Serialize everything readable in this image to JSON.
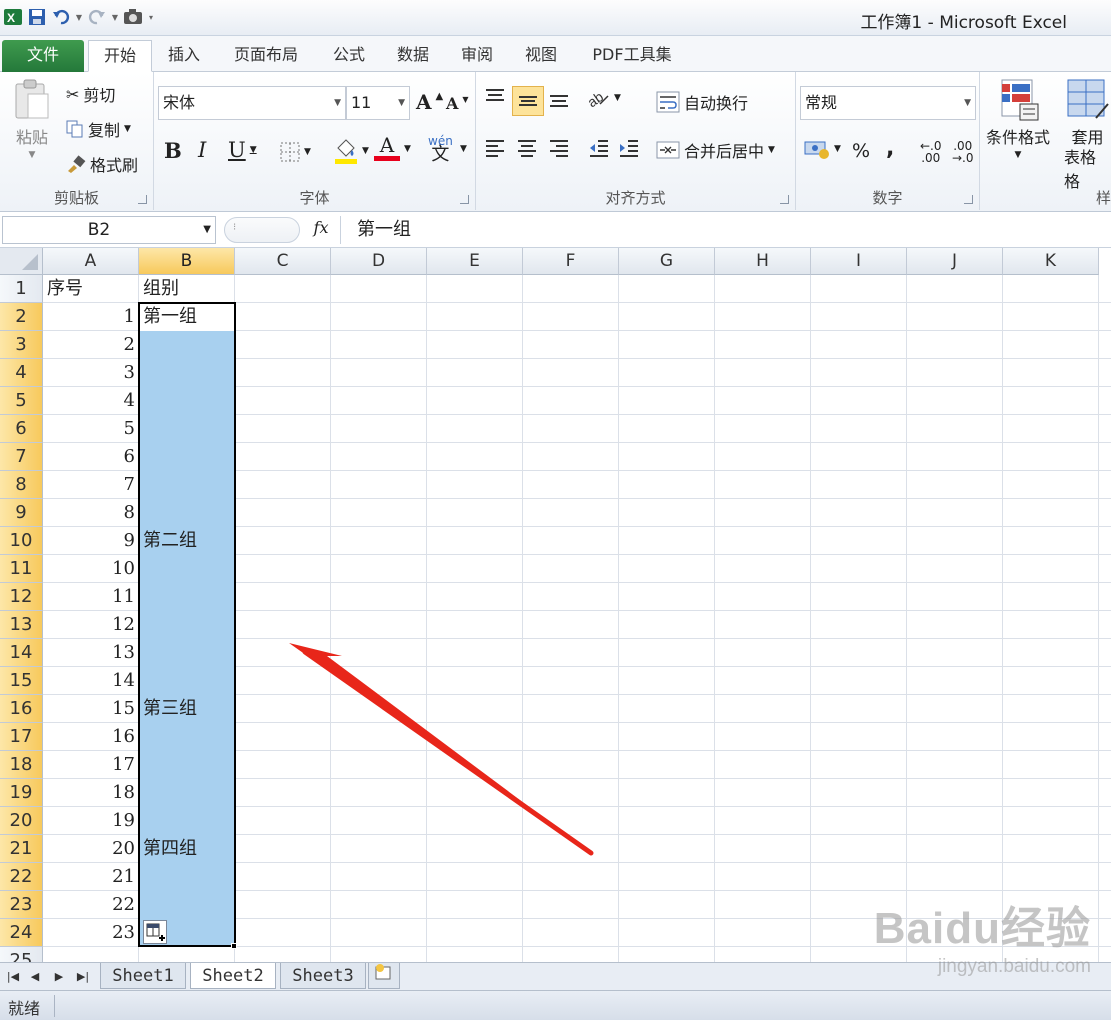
{
  "window": {
    "title": "工作簿1 - Microsoft Excel"
  },
  "ribbon_tabs": [
    "文件",
    "开始",
    "插入",
    "页面布局",
    "公式",
    "数据",
    "审阅",
    "视图",
    "PDF工具集"
  ],
  "clipboard": {
    "paste": "粘贴",
    "cut": "剪切",
    "copy": "复制",
    "format_painter": "格式刷",
    "label": "剪贴板"
  },
  "font": {
    "name": "宋体",
    "size": "11",
    "bold": "B",
    "italic": "I",
    "underline": "U",
    "color_letter": "A",
    "wen": "wén",
    "wen_char": "文",
    "label": "字体",
    "grow": "A",
    "shrink": "A"
  },
  "alignment": {
    "wrap": "自动换行",
    "merge": "合并后居中",
    "label": "对齐方式"
  },
  "number": {
    "format": "常规",
    "percent": "%",
    "comma": ",",
    "inc": ".00",
    "dec": ".00",
    "label": "数字"
  },
  "styles": {
    "conditional": "条件格式",
    "table_l1": "套用",
    "table_l2": "表格格",
    "label": "样"
  },
  "formula_bar": {
    "name_box": "B2",
    "fx": "fx",
    "content": "第一组"
  },
  "columns": [
    "A",
    "B",
    "C",
    "D",
    "E",
    "F",
    "G",
    "H",
    "I",
    "J",
    "K"
  ],
  "rows": [
    "1",
    "2",
    "3",
    "4",
    "5",
    "6",
    "7",
    "8",
    "9",
    "10",
    "11",
    "12",
    "13",
    "14",
    "15",
    "16",
    "17",
    "18",
    "19",
    "20",
    "21",
    "22",
    "23",
    "24",
    "25"
  ],
  "cells": [
    {
      "r": 1,
      "c": "A",
      "v": "序号",
      "num": false
    },
    {
      "r": 1,
      "c": "B",
      "v": "组别",
      "num": false
    },
    {
      "r": 2,
      "c": "A",
      "v": "1",
      "num": true
    },
    {
      "r": 3,
      "c": "A",
      "v": "2",
      "num": true
    },
    {
      "r": 4,
      "c": "A",
      "v": "3",
      "num": true
    },
    {
      "r": 5,
      "c": "A",
      "v": "4",
      "num": true
    },
    {
      "r": 6,
      "c": "A",
      "v": "5",
      "num": true
    },
    {
      "r": 7,
      "c": "A",
      "v": "6",
      "num": true
    },
    {
      "r": 8,
      "c": "A",
      "v": "7",
      "num": true
    },
    {
      "r": 9,
      "c": "A",
      "v": "8",
      "num": true
    },
    {
      "r": 10,
      "c": "A",
      "v": "9",
      "num": true
    },
    {
      "r": 11,
      "c": "A",
      "v": "10",
      "num": true
    },
    {
      "r": 12,
      "c": "A",
      "v": "11",
      "num": true
    },
    {
      "r": 13,
      "c": "A",
      "v": "12",
      "num": true
    },
    {
      "r": 14,
      "c": "A",
      "v": "13",
      "num": true
    },
    {
      "r": 15,
      "c": "A",
      "v": "14",
      "num": true
    },
    {
      "r": 16,
      "c": "A",
      "v": "15",
      "num": true
    },
    {
      "r": 17,
      "c": "A",
      "v": "16",
      "num": true
    },
    {
      "r": 18,
      "c": "A",
      "v": "17",
      "num": true
    },
    {
      "r": 19,
      "c": "A",
      "v": "18",
      "num": true
    },
    {
      "r": 20,
      "c": "A",
      "v": "19",
      "num": true
    },
    {
      "r": 21,
      "c": "A",
      "v": "20",
      "num": true
    },
    {
      "r": 22,
      "c": "A",
      "v": "21",
      "num": true
    },
    {
      "r": 23,
      "c": "A",
      "v": "22",
      "num": true
    },
    {
      "r": 24,
      "c": "A",
      "v": "23",
      "num": true
    },
    {
      "r": 2,
      "c": "B",
      "v": "第一组",
      "num": false
    },
    {
      "r": 10,
      "c": "B",
      "v": "第二组",
      "num": false
    },
    {
      "r": 16,
      "c": "B",
      "v": "第三组",
      "num": false
    },
    {
      "r": 21,
      "c": "B",
      "v": "第四组",
      "num": false
    }
  ],
  "sheets": [
    "Sheet1",
    "Sheet2",
    "Sheet3"
  ],
  "active_sheet": "Sheet2",
  "status": "就绪",
  "watermark": {
    "big": "Baidu经验",
    "small": "jingyan.baidu.com"
  },
  "colors": {
    "selection": "#a8d0ef",
    "header_selected": "#f7c95c",
    "arrow": "#e8261a",
    "file_tab": "#2e8a43"
  }
}
